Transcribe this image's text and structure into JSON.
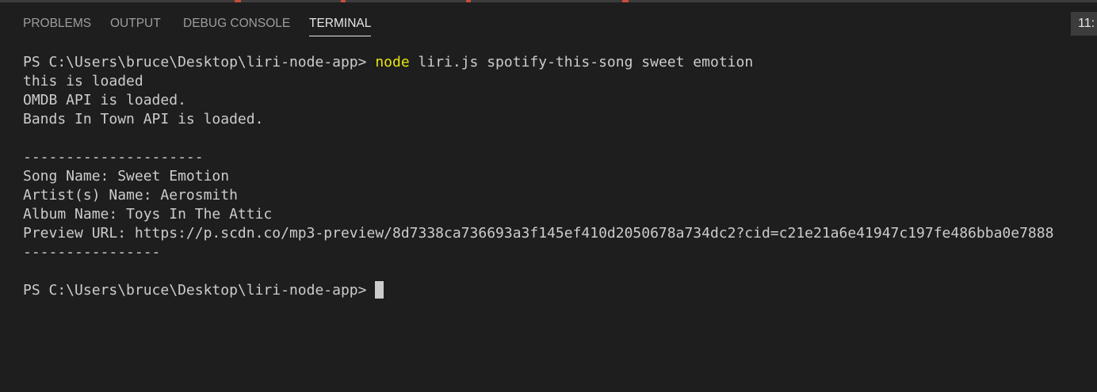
{
  "panel": {
    "tabs": [
      {
        "label": "PROBLEMS",
        "active": false
      },
      {
        "label": "OUTPUT",
        "active": false
      },
      {
        "label": "DEBUG CONSOLE",
        "active": false
      },
      {
        "label": "TERMINAL",
        "active": true
      }
    ],
    "clock_fragment": "11:"
  },
  "colors": {
    "background": "#1e1e1e",
    "text": "#cccccc",
    "command_keyword": "#e5e510",
    "active_tab": "#e7e7e7",
    "inactive_tab": "#9d9d9d"
  },
  "terminal": {
    "command_line": {
      "prompt": "PS C:\\Users\\bruce\\Desktop\\liri-node-app> ",
      "keyword": "node",
      "args": " liri.js spotify-this-song sweet emotion"
    },
    "output": [
      "this is loaded",
      "OMDB API is loaded.",
      "Bands In Town API is loaded.",
      "",
      "---------------------",
      "Song Name: Sweet Emotion",
      "Artist(s) Name: Aerosmith",
      "Album Name: Toys In The Attic",
      "Preview URL: https://p.scdn.co/mp3-preview/8d7338ca736693a3f145ef410d2050678a734dc2?cid=c21e21a6e41947c197fe486bba0e7888",
      "----------------",
      ""
    ],
    "final_prompt": "PS C:\\Users\\bruce\\Desktop\\liri-node-app> "
  }
}
